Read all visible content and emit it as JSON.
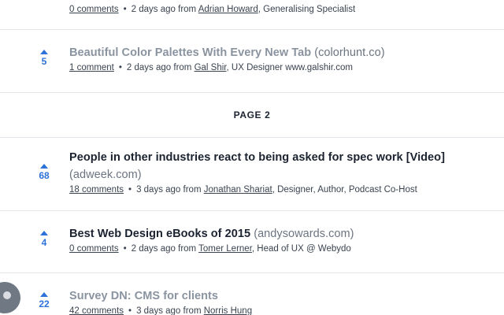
{
  "stories": [
    {
      "votes": "",
      "title": "",
      "domain": "",
      "comments": "0 comments",
      "time": "2 days ago from",
      "author": "Adrian Howard",
      "author_info": ", Generalising Specialist"
    },
    {
      "votes": "5",
      "title": "Beautiful Color Palettes With Every New Tab",
      "domain": "(colorhunt.co)",
      "comments": "1 comment",
      "time": "2 days ago from",
      "author": "Gal Shir",
      "author_info": ", UX Designer www.galshir.com",
      "read": true
    },
    {
      "votes": "68",
      "title": "People in other industries react to being asked for spec work [Video]",
      "domain": "(adweek.com)",
      "comments": "18 comments",
      "time": "3 days ago from",
      "author": "Jonathan Shariat",
      "author_info": ", Designer, Author, Podcast Co-Host"
    },
    {
      "votes": "4",
      "title": "Best Web Design eBooks of 2015",
      "domain": "(andysowards.com)",
      "comments": "0 comments",
      "time": "2 days ago from",
      "author": "Tomer Lerner",
      "author_info": ", Head of UX @ Webydo"
    },
    {
      "votes": "22",
      "title": "Survey DN: CMS for clients",
      "domain": "",
      "comments": "42 comments",
      "time": "3 days ago from",
      "author": "Norris Hung",
      "author_info": "",
      "read": true
    }
  ],
  "pagination": {
    "label": "PAGE 2"
  },
  "meta_separator": "•",
  "colors": {
    "accent": "#2d72d9",
    "divider": "#e3e6ea",
    "read_title": "#8a93a0"
  }
}
